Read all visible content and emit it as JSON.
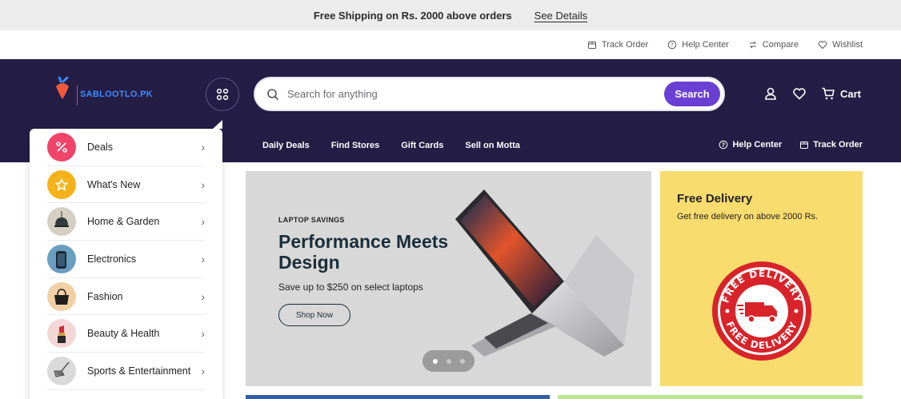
{
  "announcement": {
    "message": "Free Shipping on Rs. 2000 above orders",
    "link": "See Details"
  },
  "utility": {
    "items": [
      {
        "label": "Track Order",
        "icon": "package-icon"
      },
      {
        "label": "Help Center",
        "icon": "help-circle-icon"
      },
      {
        "label": "Compare",
        "icon": "compare-arrows-icon"
      },
      {
        "label": "Wishlist",
        "icon": "heart-icon"
      }
    ]
  },
  "header": {
    "logo_text": "SABLOOTLO.PK",
    "search": {
      "placeholder": "Search for anything",
      "button_label": "Search"
    },
    "cart_label": "Cart",
    "nav": [
      "Daily Deals",
      "Find Stores",
      "Gift Cards",
      "Sell on Motta"
    ],
    "nav_right": [
      {
        "label": "Help Center",
        "icon": "help-circle-icon"
      },
      {
        "label": "Track Order",
        "icon": "package-icon"
      }
    ]
  },
  "categories": [
    {
      "label": "Deals",
      "icon": "percent-icon",
      "color": "#f0446a"
    },
    {
      "label": "What's New",
      "icon": "star-icon",
      "color": "#f6b21b"
    },
    {
      "label": "Home & Garden",
      "icon": "lamp-icon",
      "color": "#d6cfc3"
    },
    {
      "label": "Electronics",
      "icon": "phone-icon",
      "color": "#6a9ec0"
    },
    {
      "label": "Fashion",
      "icon": "handbag-icon",
      "color": "#f2cfa4"
    },
    {
      "label": "Beauty & Health",
      "icon": "lipstick-icon",
      "color": "#f5d6d6"
    },
    {
      "label": "Sports & Entertainment",
      "icon": "golf-club-icon",
      "color": "#dadada"
    }
  ],
  "hero": {
    "eyebrow": "LAPTOP SAVINGS",
    "title": "Performance Meets Design",
    "subtitle": "Save up to $250 on select laptops",
    "button_label": "Shop Now",
    "slides_count": 3,
    "active_slide": 1
  },
  "promo": {
    "title": "Free Delivery",
    "subtitle": "Get free delivery on above 2000 Rs.",
    "seal_text_top": "FREE DELIVERY",
    "seal_text_bottom": "FREE DELIVERY"
  },
  "colors": {
    "header_bg": "#241d45",
    "accent": "#6a3fd4",
    "promo_bg": "#f9dc6e",
    "seal_red": "#d8232a"
  }
}
